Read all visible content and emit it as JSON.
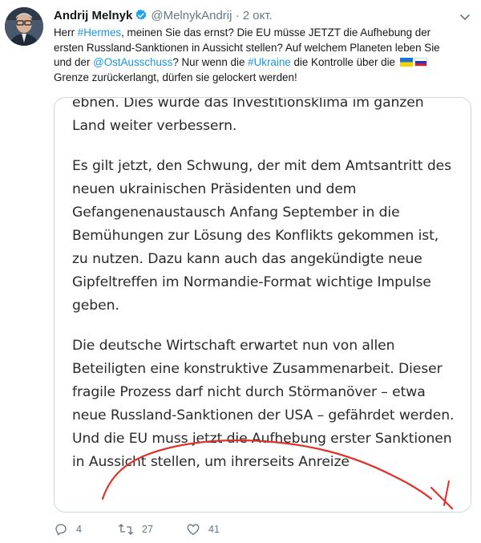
{
  "tweet": {
    "author_name": "Andrij Melnyk",
    "handle": "@MelnykAndrij",
    "date": "2 окт.",
    "separator": "·",
    "text": {
      "p1": "Herr ",
      "tag_hermes": "#Hermes",
      "p2": ", meinen Sie das ernst? Die EU müsse JETZT die Aufhebung der ersten Russland-Sanktionen in Aussicht stellen? Auf welchem Planeten leben Sie und der ",
      "mention_ost": "@OstAusschuss",
      "p3": "? Nur wenn die ",
      "tag_ukraine": "#Ukraine",
      "p4": " die Kontrolle über die ",
      "p5": " Grenze zurückerlangt, dürfen sie gelockert werden!"
    },
    "media": {
      "line0": "ebnen. Dies würde das Investitionsklima im ganzen",
      "line1": "Land weiter verbessern.",
      "para2": "Es gilt jetzt, den Schwung, der mit dem Amtsantritt des neuen ukrainischen Präsidenten und dem Gefangenenaustausch Anfang September in die Bemühungen zur Lösung des Konflikts gekommen ist, zu nutzen. Dazu kann auch das angekündigte neue Gipfeltreffen im Normandie-Format wichtige Impulse geben.",
      "para3": "Die deutsche Wirtschaft erwartet nun von allen Beteiligten eine konstruktive Zusammenarbeit. Dieser fragile Prozess darf nicht durch Störmanöver – etwa neue Russland-Sanktionen der USA – gefährdet werden. Und die EU muss jetzt die Aufhebung erster Sanktionen in Aussicht stellen, um ihrerseits Anreize"
    },
    "actions": {
      "replies": "4",
      "retweets": "27",
      "likes": "41"
    }
  },
  "icons": {
    "verified": "verified-badge-icon",
    "caret": "chevron-down-icon",
    "reply": "reply-icon",
    "retweet": "retweet-icon",
    "like": "heart-icon",
    "flag_ua": "ukraine-flag-icon",
    "flag_ru": "russia-flag-icon"
  },
  "colors": {
    "link": "#1b95e0",
    "secondary_text": "#657786",
    "verified": "#1da1f2",
    "scribble": "#e0312b"
  }
}
